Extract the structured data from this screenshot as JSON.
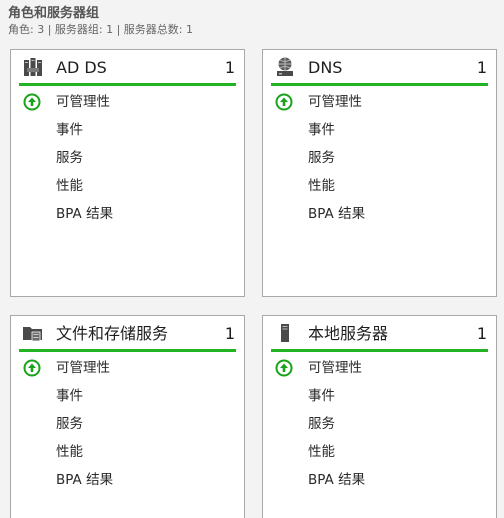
{
  "header": {
    "title": "角色和服务器组",
    "subtitle": "角色: 3 | 服务器组: 1 | 服务器总数: 1"
  },
  "colors": {
    "accent_bar": "#21b321",
    "status_ok": "#1aa31a"
  },
  "tiles": [
    {
      "title": "AD DS",
      "count": "1",
      "icon": "ad-ds-icon",
      "rows": {
        "manageability": "可管理性",
        "events": "事件",
        "services": "服务",
        "performance": "性能",
        "bpa": "BPA 结果"
      }
    },
    {
      "title": "DNS",
      "count": "1",
      "icon": "dns-icon",
      "rows": {
        "manageability": "可管理性",
        "events": "事件",
        "services": "服务",
        "performance": "性能",
        "bpa": "BPA 结果"
      }
    },
    {
      "title": "文件和存储服务",
      "count": "1",
      "icon": "file-storage-icon",
      "rows": {
        "manageability": "可管理性",
        "events": "事件",
        "services": "服务",
        "performance": "性能",
        "bpa": "BPA 结果"
      }
    },
    {
      "title": "本地服务器",
      "count": "1",
      "icon": "local-server-icon",
      "rows": {
        "manageability": "可管理性",
        "events": "事件",
        "services": "服务",
        "performance": "性能",
        "bpa": "BPA 结果"
      }
    }
  ]
}
